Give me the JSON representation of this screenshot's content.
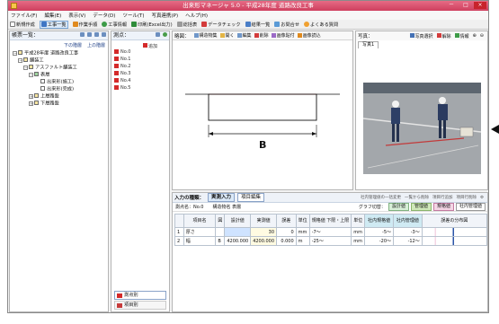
{
  "window": {
    "title": "出来形マネージャ 5.0 - 平成28年度 道路改良工事",
    "buttons": [
      "－",
      "□",
      "×"
    ]
  },
  "menu": [
    "ファイル(F)",
    "編集(E)",
    "表示(V)",
    "データ(D)",
    "ツール(T)",
    "写真連携(P)",
    "ヘルプ(H)"
  ],
  "toolbar": [
    "新規作成",
    "工事一覧",
    "作業手順",
    "工事情報",
    "印刷(Excel出力)",
    "総括表",
    "データチェック",
    "結果一覧",
    "お問合せ",
    "よくある質問"
  ],
  "tree": {
    "title": "帳票一覧：",
    "sub_links": [
      "下の階層",
      "上の階層"
    ],
    "nodes": [
      "平成28年度 道路改良工事",
      "舗装工",
      "アスファルト舗装工",
      "表層",
      "出来形(施工)",
      "出来形(完成)",
      "上層路盤",
      "下層路盤"
    ]
  },
  "points": {
    "title": "測点：",
    "add_label": "追加",
    "items": [
      "No.0",
      "No.1",
      "No.2",
      "No.3",
      "No.4",
      "No.5"
    ],
    "tabs": [
      "測点別",
      "項目別"
    ]
  },
  "diagram": {
    "title": "略図：",
    "tools": [
      "構造物集",
      "開く",
      "編集",
      "削除",
      "画像貼付",
      "画像読込"
    ],
    "label": "B"
  },
  "photo": {
    "title": "写真：",
    "tools": [
      "写真選択",
      "解除",
      "情報"
    ],
    "tab": "写真1"
  },
  "input": {
    "title": "入力の種類：",
    "tabs": [
      "実測入力",
      "項目編集"
    ],
    "right_tools": [
      "社内管理値の一括変更",
      "一覧から削除",
      "項目行追加",
      "項目行削除"
    ],
    "point_label": "測点名：No.0",
    "kind_label": "構造物名 表層",
    "graph_label": "グラフ切替：",
    "chips": [
      "設計値",
      "管理値",
      "規格値",
      "社内管理値"
    ],
    "headers": [
      "",
      "項目名",
      "図",
      "設計値",
      "実測値",
      "誤差",
      "単位",
      "規格値 下限・上限",
      "単位",
      "社内規格値",
      "社内管理値",
      "誤差の分布図"
    ],
    "rows": [
      [
        "1",
        "厚さ",
        "",
        "",
        "30",
        "0",
        "mm",
        "-7〜",
        "mm",
        "-5〜",
        "-3〜"
      ],
      [
        "2",
        "幅",
        "B",
        "4200.000",
        "4200.000",
        "0.000",
        "m",
        "-25〜",
        "mm",
        "-20〜",
        "-12〜"
      ]
    ]
  },
  "colors": {
    "titlebar": "#d9506e",
    "flag": "#d42a2a",
    "accent": "#4471b5"
  }
}
